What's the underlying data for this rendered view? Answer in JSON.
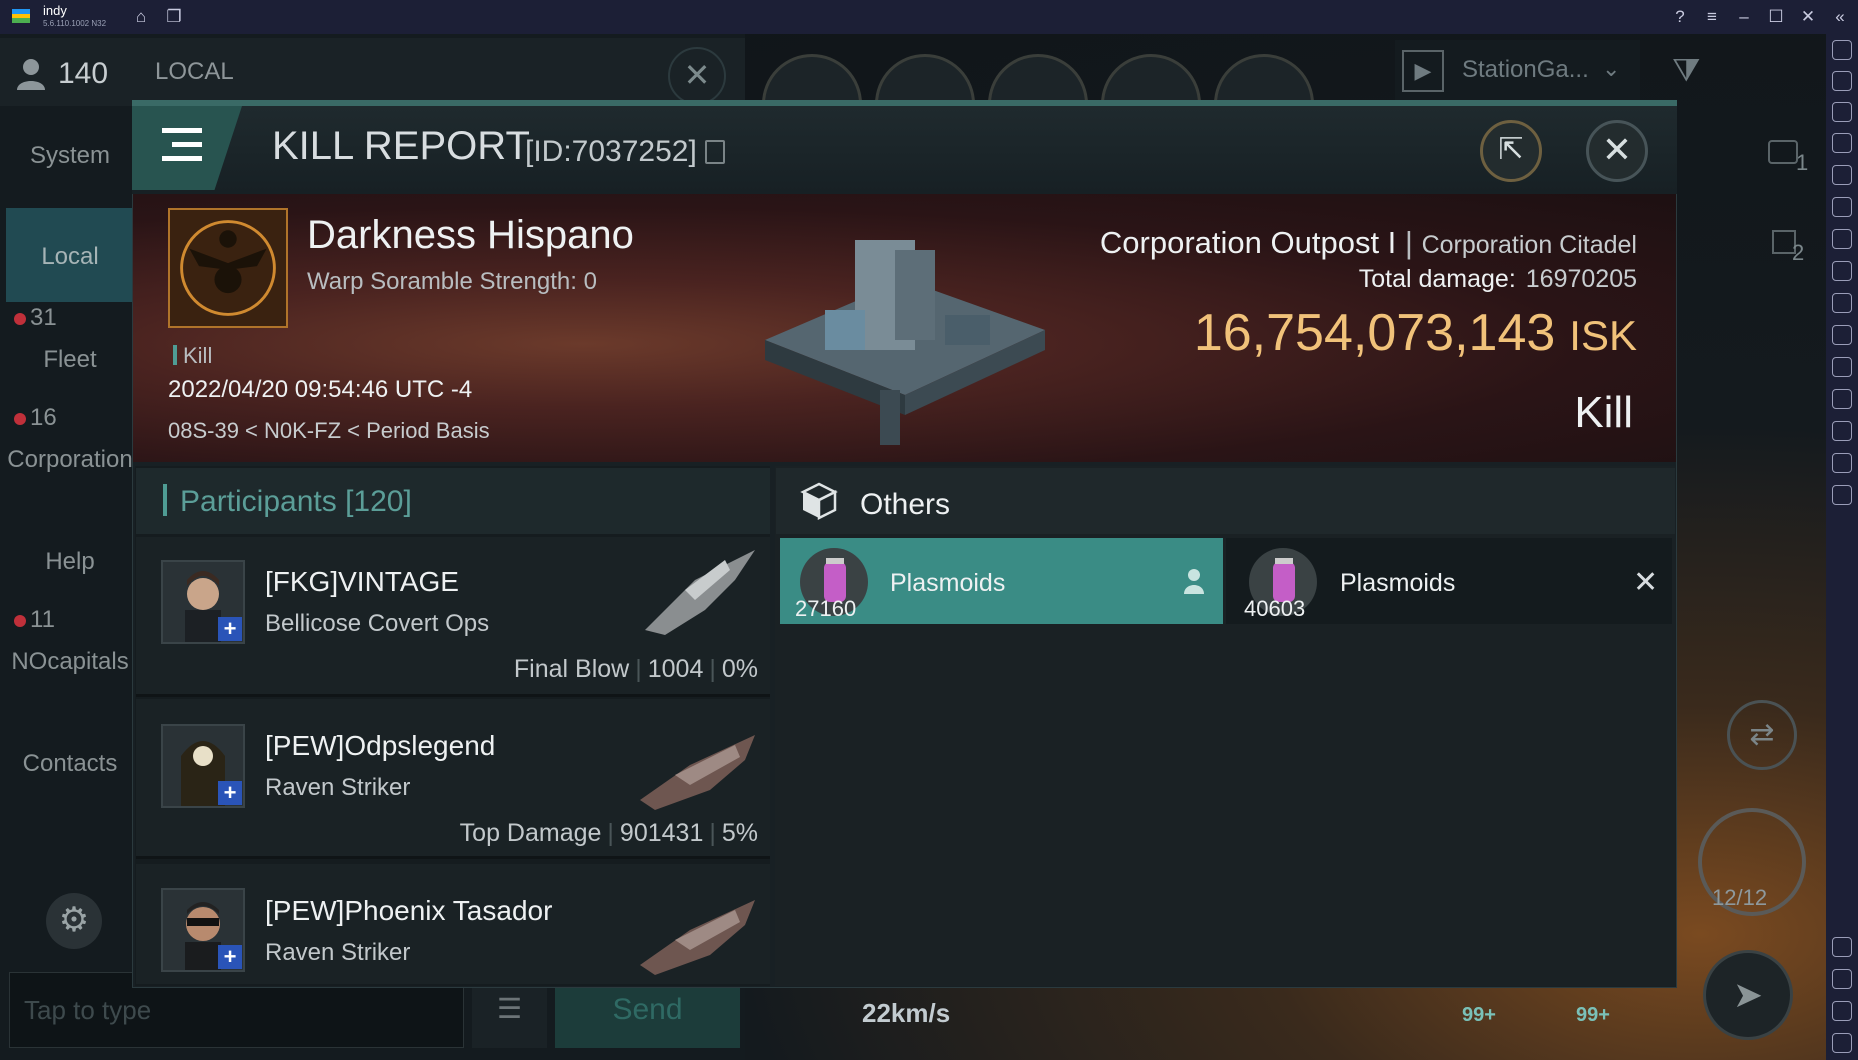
{
  "emulator": {
    "title": "indy",
    "version": "5.6.110.1002 N32",
    "title_icons": [
      "home-icon",
      "multi-instance-icon"
    ],
    "window_icons": [
      "help-icon",
      "menu-icon",
      "minimize-icon",
      "maximize-icon",
      "close-icon",
      "collapse-icon"
    ],
    "sidebar_icons": [
      "fullscreen-icon",
      "volume-icon",
      "media-icon",
      "keyboard-icon",
      "rotate-icon",
      "sync-icon",
      "controller-icon",
      "screenshot-icon",
      "scan-icon",
      "folder-icon",
      "multi-window-icon",
      "erase-icon",
      "location-icon",
      "layers-icon",
      "replay-icon",
      "settings-icon",
      "back-icon",
      "home-icon",
      "recents-icon"
    ]
  },
  "chat": {
    "pilot_count": "140",
    "channel_title": "LOCAL",
    "sidebar": [
      {
        "label": "System"
      },
      {
        "label": "Local"
      },
      {
        "label": "Fleet",
        "count": "31"
      },
      {
        "label": "Corporation",
        "count": "16"
      },
      {
        "label": "Help"
      },
      {
        "label": "NOcapitals",
        "count": "11"
      },
      {
        "label": "Contacts"
      }
    ],
    "input_placeholder": "Tap to type",
    "send_label": "Send"
  },
  "hud": {
    "station_label": "StationGa...",
    "speed": "22km/s",
    "ship_counter": "12/12",
    "badge_a": "99+",
    "badge_b": "99+",
    "overview_count_1": "1",
    "overview_count_2": "2"
  },
  "kill_report": {
    "title": "KILL REPORT",
    "id_label": "[ID:7037252]",
    "victim": {
      "name": "Darkness Hispano",
      "warp_scramble": "Warp Soramble Strength: 0",
      "tag": "Kill",
      "datetime": "2022/04/20 09:54:46 UTC -4",
      "location": "08S-39 < N0K-FZ < Period Basis"
    },
    "target": {
      "ship_name": "Corporation Outpost I",
      "ship_class": "Corporation Citadel",
      "total_damage_label": "Total damage:",
      "total_damage": "16970205",
      "isk_value": "16,754,073,143",
      "isk_unit": "ISK",
      "result": "Kill"
    },
    "participants_label": "Participants",
    "participants_count": "[120]",
    "participants": [
      {
        "name": "[FKG]VINTAGE",
        "ship": "Bellicose Covert Ops",
        "role": "Final Blow",
        "damage": "1004",
        "percent": "0%"
      },
      {
        "name": "[PEW]Odpslegend",
        "ship": "Raven Striker",
        "role": "Top Damage",
        "damage": "901431",
        "percent": "5%"
      },
      {
        "name": "[PEW]Phoenix Tasador",
        "ship": "Raven Striker"
      }
    ],
    "others_label": "Others",
    "others": [
      {
        "name": "Plasmoids",
        "quantity": "27160"
      },
      {
        "name": "Plasmoids",
        "quantity": "40603"
      }
    ]
  }
}
